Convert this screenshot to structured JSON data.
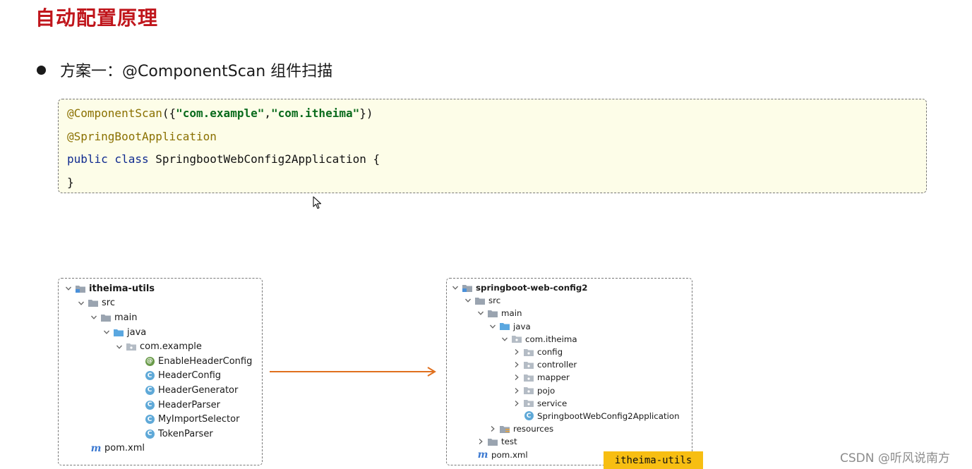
{
  "title": "自动配置原理",
  "bullet": "方案一：@ComponentScan 组件扫描",
  "code": {
    "line1_anno": "@ComponentScan",
    "line1_open": "({",
    "line1_str1": "\"com.example\"",
    "line1_comma": ",",
    "line1_str2": "\"com.itheima\"",
    "line1_close": "})",
    "line2_anno": "@SpringBootApplication",
    "line3_kw": "public class",
    "line3_rest": " SpringbootWebConfig2Application {",
    "line4": "}"
  },
  "left_tree": {
    "root": "itheima-utils",
    "src": "src",
    "main": "main",
    "java": "java",
    "package": "com.example",
    "classes": [
      "EnableHeaderConfig",
      "HeaderConfig",
      "HeaderGenerator",
      "HeaderParser",
      "MyImportSelector",
      "TokenParser"
    ],
    "pom": "pom.xml"
  },
  "right_tree": {
    "root": "springboot-web-config2",
    "src": "src",
    "main": "main",
    "java": "java",
    "package": "com.itheima",
    "subpackages": [
      "config",
      "controller",
      "mapper",
      "pojo",
      "service"
    ],
    "app_class": "SpringbootWebConfig2Application",
    "resources": "resources",
    "test": "test",
    "pom": "pom.xml"
  },
  "tag": "itheima-utils",
  "watermark": "CSDN @听风说南方",
  "colors": {
    "title": "#c0161c",
    "code_bg": "#fdfde8",
    "annotation": "#8a7000",
    "string": "#0a6b1c",
    "keyword": "#0f2a8f",
    "arrow": "#e0701e",
    "tag_bg": "#f7be12"
  }
}
